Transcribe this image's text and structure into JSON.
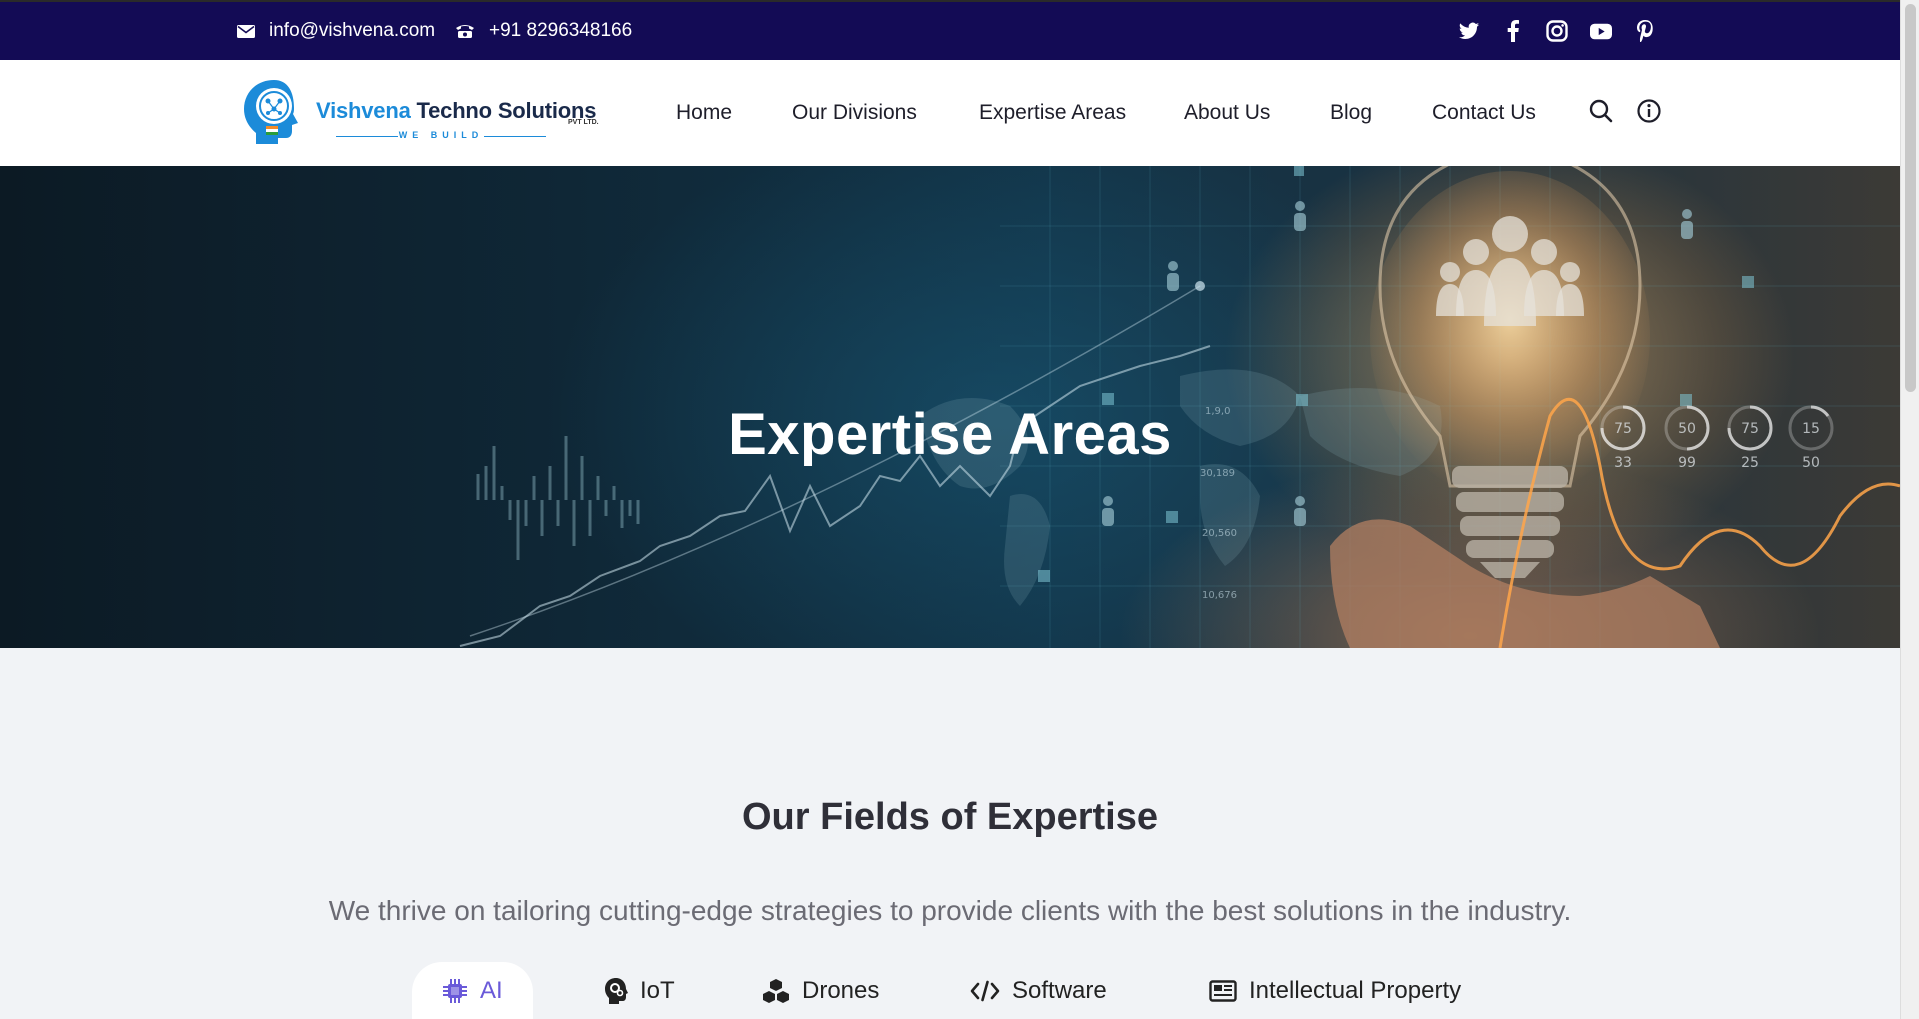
{
  "topbar": {
    "email": "info@vishvena.com",
    "phone": "+91 8296348166",
    "socials": [
      "twitter-icon",
      "facebook-icon",
      "instagram-icon",
      "youtube-icon",
      "pinterest-icon"
    ]
  },
  "brand": {
    "name_part1": "Vishvena",
    "name_part2": " Techno Solutions",
    "suffix": "PVT LTD.",
    "tagline": "WE BUILD",
    "colors": {
      "navy": "#130b55",
      "blue": "#1c8bd9"
    }
  },
  "nav": {
    "items": [
      "Home",
      "Our Divisions",
      "Expertise Areas",
      "About Us",
      "Blog",
      "Contact Us"
    ],
    "icons": [
      "search-icon",
      "info-icon"
    ]
  },
  "hero": {
    "title": "Expertise Areas",
    "gauges": [
      {
        "top": "75",
        "bottom": "33"
      },
      {
        "top": "50",
        "bottom": "99"
      },
      {
        "top": "75",
        "bottom": "25"
      },
      {
        "top": "15",
        "bottom": "50"
      }
    ],
    "map_labels": [
      "1,9,0",
      "30,189",
      "20,560",
      "10,676"
    ]
  },
  "section": {
    "title": "Our Fields of Expertise",
    "subtitle": "We thrive on tailoring cutting-edge strategies to provide clients with the best solutions in the industry.",
    "tabs": [
      {
        "label": "AI",
        "icon": "chip-icon",
        "active": true
      },
      {
        "label": "IoT",
        "icon": "head-gears-icon",
        "active": false
      },
      {
        "label": "Drones",
        "icon": "cubes-icon",
        "active": false
      },
      {
        "label": "Software",
        "icon": "code-icon",
        "active": false
      },
      {
        "label": "Intellectual Property",
        "icon": "newspaper-icon",
        "active": false
      }
    ],
    "accent": "#6a5ad9"
  }
}
